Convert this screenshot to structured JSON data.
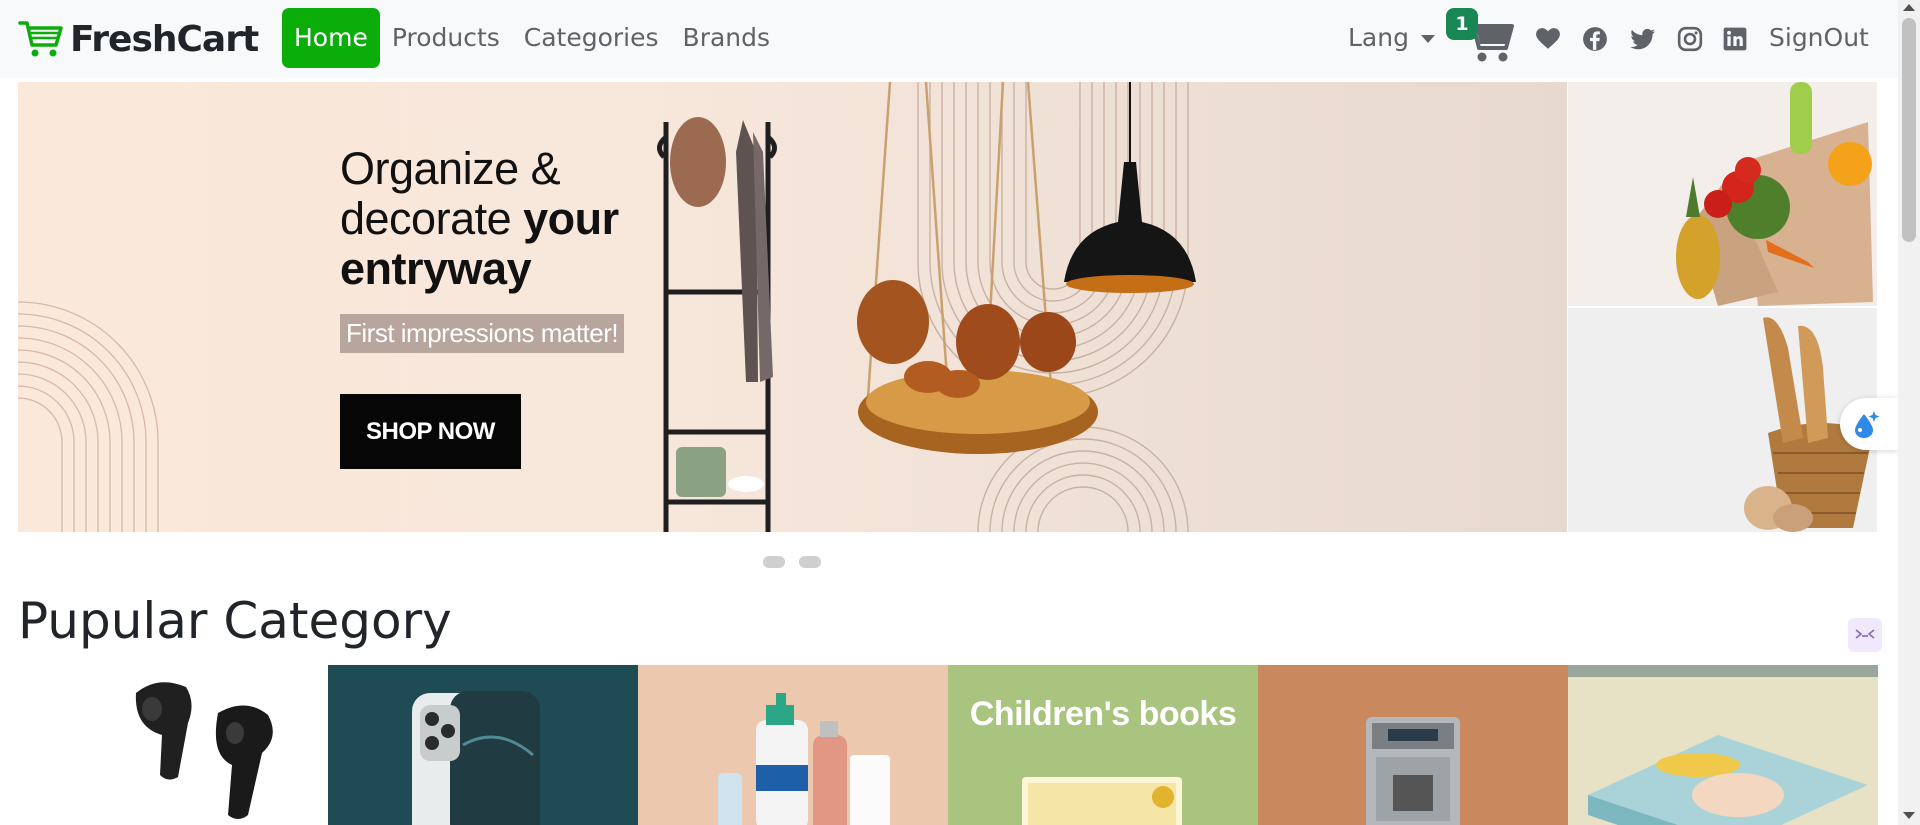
{
  "brand": {
    "name": "FreshCart",
    "icon": "cart-icon",
    "accent": "#0aad0a"
  },
  "nav": {
    "links": [
      {
        "label": "Home",
        "active": true
      },
      {
        "label": "Products",
        "active": false
      },
      {
        "label": "Categories",
        "active": false
      },
      {
        "label": "Brands",
        "active": false
      }
    ]
  },
  "header_right": {
    "lang_label": "Lang",
    "cart_count": "1",
    "cart_icon": "cart-icon",
    "social_icons": [
      "heart-icon",
      "facebook-icon",
      "twitter-icon",
      "instagram-icon",
      "linkedin-icon"
    ],
    "signout_label": "SignOut"
  },
  "hero": {
    "title_line1": "Organize &",
    "title_line2_regular": "decorate ",
    "title_line2_bold": "your",
    "title_line3_bold": "entryway",
    "subtitle": "First impressions matter!",
    "button_label": "SHOP NOW",
    "slide_count": 2
  },
  "side_banners": [
    "grocery-bag-banner",
    "bread-basket-banner"
  ],
  "section": {
    "title": "Pupular Category",
    "categories": [
      {
        "name": "earbuds",
        "bg": "#ffffff"
      },
      {
        "name": "phone",
        "bg": "#1d4c55"
      },
      {
        "name": "skincare",
        "bg": "#e9c6ad"
      },
      {
        "name": "childrens-books",
        "bg": "#a8c47e",
        "caption": "Children's books"
      },
      {
        "name": "coffee-machine",
        "bg": "#c8865b"
      },
      {
        "name": "diapers",
        "bg": "#e8e4c8"
      }
    ]
  }
}
